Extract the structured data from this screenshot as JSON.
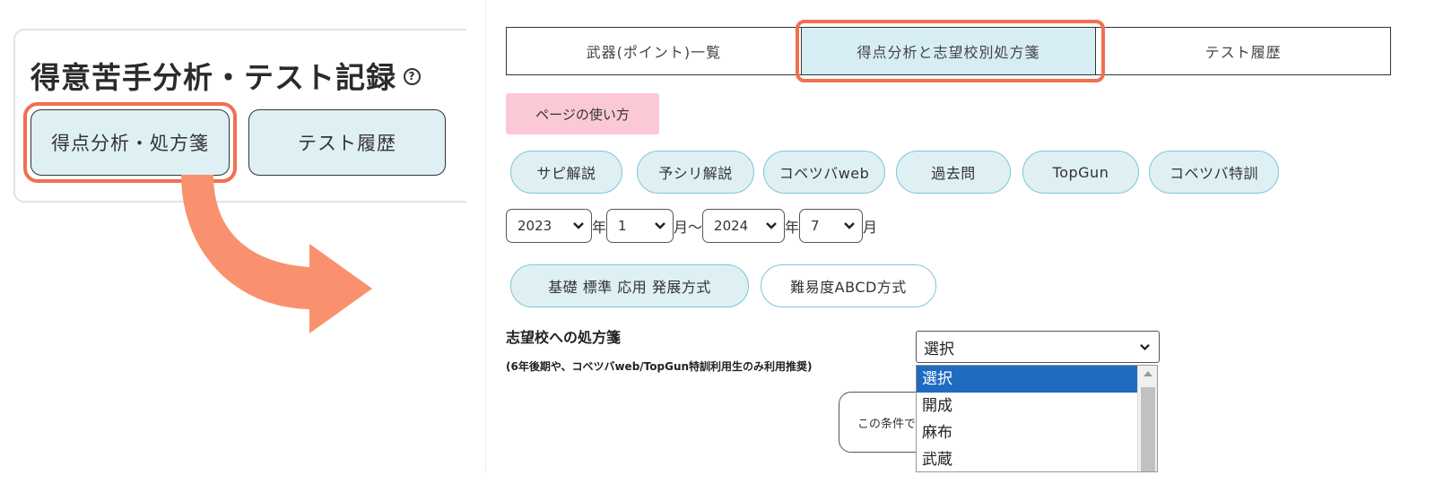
{
  "left": {
    "title": "得意苦手分析・テスト記録",
    "help_icon": "?",
    "buttons": [
      "得点分析・処方箋",
      "テスト履歴"
    ]
  },
  "tabs": [
    "武器(ポイント)一覧",
    "得点分析と志望校別処方箋",
    "テスト履歴"
  ],
  "howto": "ページの使い方",
  "sources": [
    "サピ解説",
    "予シリ解説",
    "コベツバweb",
    "過去問",
    "TopGun",
    "コベツバ特訓"
  ],
  "date": {
    "start_year": "2023",
    "year_label": "年",
    "start_month": "1",
    "month_label": "月～",
    "end_year": "2024",
    "end_month": "7",
    "end_month_label": "月"
  },
  "modes": [
    "基礎 標準 応用 発展方式",
    "難易度ABCD方式"
  ],
  "prescription": {
    "label": "志望校への処方箋",
    "note": "(6年後期や、コベツバweb/TopGun特訓利用生のみ利用推奨)",
    "selected": "選択",
    "options": [
      "選択",
      "開成",
      "麻布",
      "武蔵"
    ]
  },
  "search_button": "この条件で",
  "colors": {
    "highlight": "#f07050",
    "arrow": "#f9916f",
    "tab_active": "#d7edf4",
    "pill_bg": "#dff0f5",
    "pill_border": "#7cc6d6",
    "howto_bg": "#fbc9d6",
    "dropdown_selected": "#1e6bc0"
  }
}
